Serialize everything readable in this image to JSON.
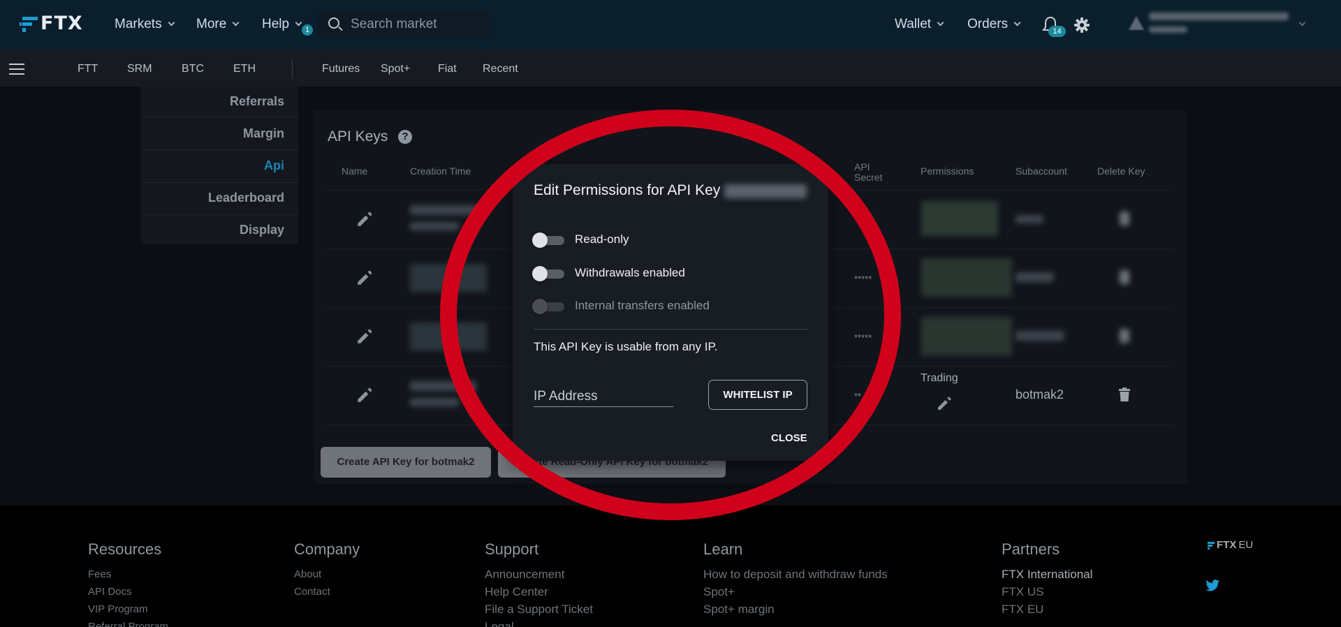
{
  "brand": {
    "name": "FTX",
    "accent": "#1d9bd1"
  },
  "topnav": {
    "items": [
      {
        "label": "Markets"
      },
      {
        "label": "More"
      },
      {
        "label": "Help"
      }
    ],
    "help_badge": "1",
    "search_placeholder": "Search market",
    "wallet_label": "Wallet",
    "orders_label": "Orders",
    "notifications_badge": "14"
  },
  "subnav": {
    "coins": [
      "FTT",
      "SRM",
      "BTC",
      "ETH"
    ],
    "sections": [
      "Futures",
      "Spot+",
      "Fiat",
      "Recent"
    ]
  },
  "sidebar": {
    "items": [
      {
        "label": "Referrals",
        "active": false
      },
      {
        "label": "Margin",
        "active": false
      },
      {
        "label": "Api",
        "active": true
      },
      {
        "label": "Leaderboard",
        "active": false
      },
      {
        "label": "Display",
        "active": false
      }
    ]
  },
  "api_keys": {
    "title": "API Keys",
    "help_glyph": "?",
    "columns": {
      "name": "Name",
      "creation_time": "Creation Time",
      "api_secret_line1": "API",
      "api_secret_line2": "Secret",
      "permissions": "Permissions",
      "subaccount": "Subaccount",
      "delete_key": "Delete Key"
    },
    "rows": [
      {
        "secret": "*****",
        "permission": "",
        "subaccount": ""
      },
      {
        "secret": "*****",
        "permission": "",
        "subaccount": ""
      },
      {
        "secret": "*****",
        "permission": "",
        "subaccount": ""
      },
      {
        "secret": "**",
        "permission": "Trading",
        "subaccount": "botmak2"
      }
    ],
    "create_button": "Create API Key for botmak2",
    "create_readonly_button": "Create Read-Only API Key for botmak2"
  },
  "modal": {
    "title": "Edit Permissions for API Key",
    "toggles": [
      {
        "label": "Read-only",
        "enabled": false,
        "disabled": false
      },
      {
        "label": "Withdrawals enabled",
        "enabled": false,
        "disabled": false
      },
      {
        "label": "Internal transfers enabled",
        "enabled": false,
        "disabled": true
      }
    ],
    "ip_note": "This API Key is usable from any IP.",
    "ip_placeholder": "IP Address",
    "whitelist_button": "WHITELIST IP",
    "close_button": "CLOSE"
  },
  "footer": {
    "resources": {
      "heading": "Resources",
      "links": [
        "Fees",
        "API Docs",
        "VIP Program",
        "Referral Program"
      ]
    },
    "company": {
      "heading": "Company",
      "links": [
        "About",
        "Contact"
      ]
    },
    "support": {
      "heading": "Support",
      "links": [
        "Announcement",
        "Help Center",
        "File a Support Ticket",
        "Legal"
      ]
    },
    "learn": {
      "heading": "Learn",
      "links": [
        "How to deposit and withdraw funds",
        "Spot+",
        "Spot+ margin"
      ]
    },
    "partners": {
      "heading": "Partners",
      "links": [
        "FTX International",
        "FTX US",
        "FTX EU"
      ]
    },
    "brand_eu": "FTX",
    "brand_eu_suffix": "EU"
  },
  "overlay": {
    "circle_color": "#d0021b"
  }
}
